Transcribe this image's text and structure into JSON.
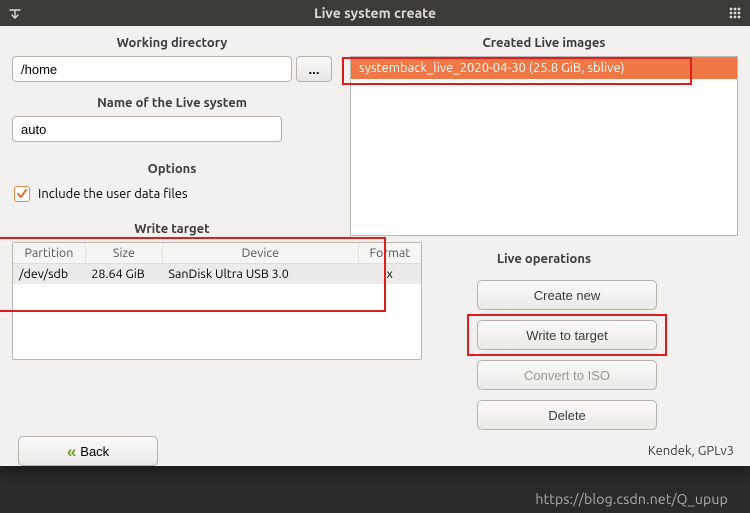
{
  "title": "Live system create",
  "left": {
    "working_dir_label": "Working directory",
    "working_dir_value": "/home",
    "browse_label": "...",
    "name_label": "Name of the Live system",
    "name_value": "auto",
    "options_label": "Options",
    "include_user_label": "Include the user data files",
    "write_target_label": "Write target",
    "table": {
      "headers": {
        "partition": "Partition",
        "size": "Size",
        "device": "Device",
        "format": "Format"
      },
      "row": {
        "partition": "/dev/sdb",
        "size": "28.64 GiB",
        "device": "SanDisk Ultra USB 3.0",
        "format": "x"
      }
    }
  },
  "right": {
    "images_label": "Created Live images",
    "image_item": "systemback_live_2020-04-30 (25.8 GiB, sblive)",
    "ops_label": "Live operations",
    "buttons": {
      "create": "Create new",
      "write": "Write to target",
      "convert": "Convert to ISO",
      "delete": "Delete"
    }
  },
  "back_label": "Back",
  "credit": "Kendek, GPLv3",
  "watermark": "https://blog.csdn.net/Q_upup"
}
